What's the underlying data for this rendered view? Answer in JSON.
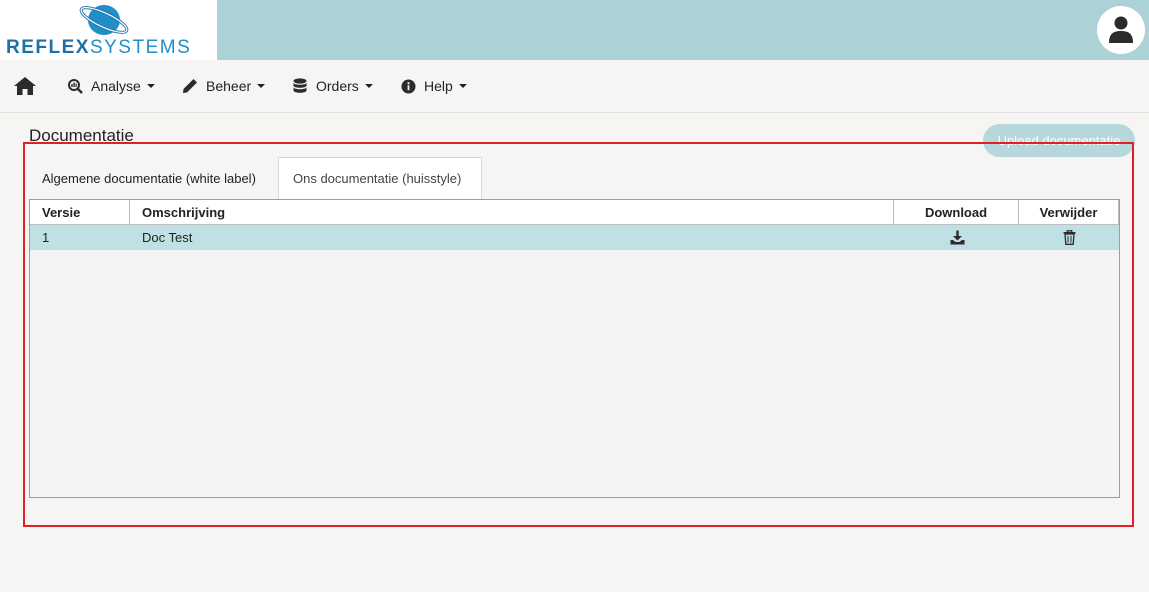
{
  "header": {
    "logo_word_bold": "REFLEX",
    "logo_word_light": "SYSTEMS",
    "user_icon": "user-icon"
  },
  "nav": {
    "home_icon": "home-icon",
    "items": [
      {
        "label": "Analyse",
        "icon": "chart-search-icon"
      },
      {
        "label": "Beheer",
        "icon": "pencil-icon"
      },
      {
        "label": "Orders",
        "icon": "database-icon"
      },
      {
        "label": "Help",
        "icon": "info-icon"
      }
    ]
  },
  "page": {
    "title": "Documentatie",
    "upload_label": "Upload documentatie"
  },
  "tabs": [
    {
      "label": "Algemene documentatie (white label)",
      "active": false
    },
    {
      "label": "Ons documentatie (huisstyle)",
      "active": true
    }
  ],
  "table": {
    "columns": [
      "Versie",
      "Omschrijving",
      "Download",
      "Verwijder"
    ],
    "rows": [
      {
        "versie": "1",
        "omschrijving": "Doc Test",
        "download_icon": "download-icon",
        "delete_icon": "trash-icon"
      }
    ]
  },
  "colors": {
    "header_bg": "#acd2d7",
    "row_selected": "#bfe1e5",
    "highlight": "#e01f26"
  }
}
